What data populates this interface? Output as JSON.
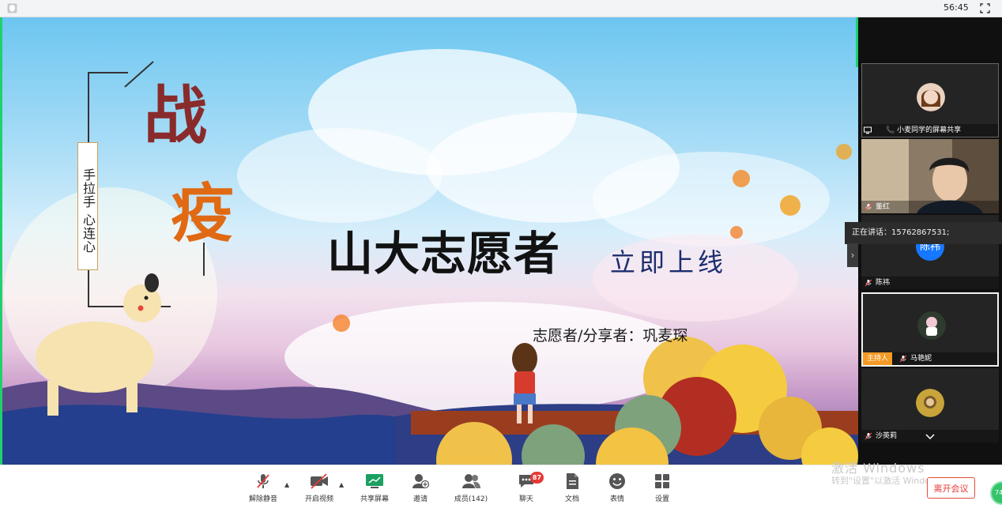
{
  "top_bar": {
    "timer": "56:45"
  },
  "slide": {
    "vertical_text": "手拉手 心连心",
    "char_zhan": "战",
    "char_yi": "疫",
    "title_main": "山大志愿者",
    "title_sub": "立即上线",
    "presenter": "志愿者/分享者：巩麦琛"
  },
  "participants": [
    {
      "label": "小麦同学的屏幕共享"
    },
    {
      "label": "董红"
    },
    {
      "label": "陈祎",
      "avatar_text": "陈祎"
    },
    {
      "label": "马艳妮",
      "badge": "主持人"
    },
    {
      "label": "沙英莉"
    }
  ],
  "speaking_tip": "正在讲话：15762867531;",
  "toolbar": {
    "mute": "解除静音",
    "video": "开启视频",
    "share": "共享屏幕",
    "invite": "邀请",
    "members": "成员(142)",
    "chat": "聊天",
    "chat_badge": "87",
    "docs": "文档",
    "emoji": "表情",
    "settings": "设置",
    "leave": "离开会议"
  },
  "watermark": {
    "line1": "激活 Windows",
    "line2": "转到\"设置\"以激活 Windows。"
  },
  "network_indicator": "74",
  "colors": {
    "accent_green": "#1fd16b",
    "leave_red": "#e53935",
    "host_orange": "#f59a23",
    "avatar_blue": "#1677ff"
  }
}
